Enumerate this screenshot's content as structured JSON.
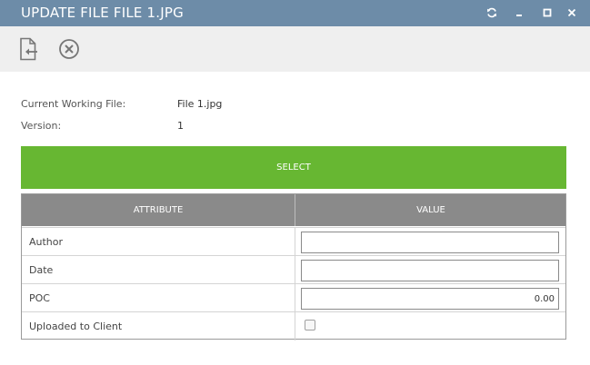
{
  "window": {
    "title": "UPDATE FILE FILE 1.JPG",
    "controls": [
      "refresh-icon",
      "minimize-icon",
      "maximize-icon",
      "close-icon"
    ],
    "colors": {
      "titlebar": "#6d8ca8",
      "toolbar": "#efefef"
    }
  },
  "toolbar": {
    "buttons": [
      "replace-file-icon",
      "cancel-circle-icon"
    ]
  },
  "info": {
    "current_file_label": "Current Working File:",
    "current_file_value": "File 1.jpg",
    "version_label": "Version:",
    "version_value": "1"
  },
  "select_button": {
    "label": "SELECT",
    "color": "#67b732"
  },
  "table": {
    "headers": {
      "attribute": "ATTRIBUTE",
      "value": "VALUE"
    },
    "header_color": "#8a8a8a",
    "rows": [
      {
        "label": "Author",
        "value": ""
      },
      {
        "label": "Date",
        "value": ""
      },
      {
        "label": "POC",
        "value": "0.00"
      },
      {
        "label": "Uploaded to Client",
        "checked": false
      }
    ]
  }
}
